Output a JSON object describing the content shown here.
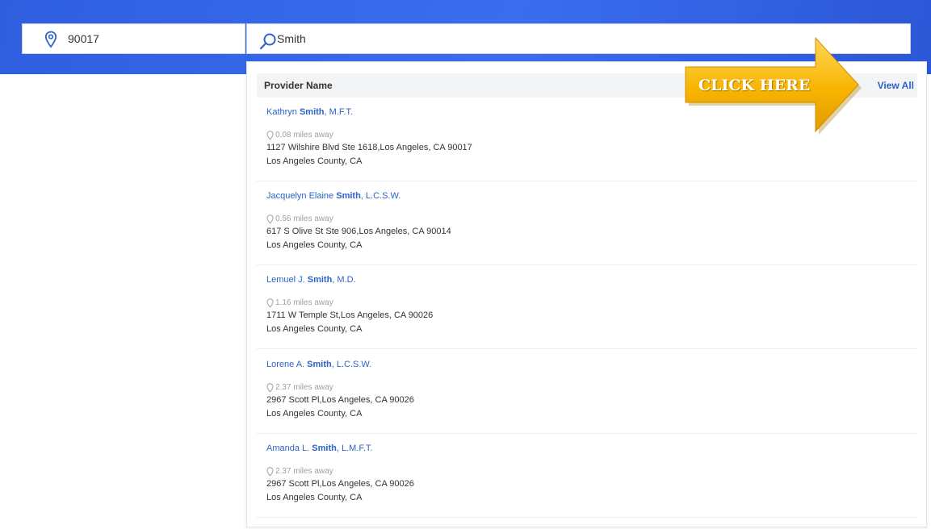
{
  "search_bar": {
    "location_value": "90017",
    "query_value": "Smith"
  },
  "dropdown": {
    "column_header": "Provider Name",
    "view_all_label": "View All",
    "results": [
      {
        "name_before": "Kathryn ",
        "name_match": "Smith",
        "name_after": ", M.F.T.",
        "distance": "0.08 miles away",
        "address": "1127 Wilshire Blvd Ste 1618,Los Angeles, CA 90017",
        "county": "Los Angeles County, CA"
      },
      {
        "name_before": "Jacquelyn Elaine ",
        "name_match": "Smith",
        "name_after": ", L.C.S.W.",
        "distance": "0.56 miles away",
        "address": "617 S Olive St Ste 906,Los Angeles, CA 90014",
        "county": "Los Angeles County, CA"
      },
      {
        "name_before": "Lemuel J. ",
        "name_match": "Smith",
        "name_after": ", M.D.",
        "distance": "1.16 miles away",
        "address": "1711 W Temple St,Los Angeles, CA 90026",
        "county": "Los Angeles County, CA"
      },
      {
        "name_before": "Lorene A. ",
        "name_match": "Smith",
        "name_after": ", L.C.S.W.",
        "distance": "2.37 miles away",
        "address": "2967 Scott Pl,Los Angeles, CA 90026",
        "county": "Los Angeles County, CA"
      },
      {
        "name_before": "Amanda L. ",
        "name_match": "Smith",
        "name_after": ", L.M.F.T.",
        "distance": "2.37 miles away",
        "address": "2967 Scott Pl,Los Angeles, CA 90026",
        "county": "Los Angeles County, CA"
      }
    ]
  },
  "callout": {
    "label": "CLICK HERE"
  },
  "icons": {
    "location": "location-pin-icon",
    "search": "search-icon",
    "distance": "map-pin-icon",
    "callout": "arrow-right-icon"
  },
  "colors": {
    "topbar": "#3a6df0",
    "link": "#2d62c8",
    "callout_fill": "#f5b400"
  }
}
